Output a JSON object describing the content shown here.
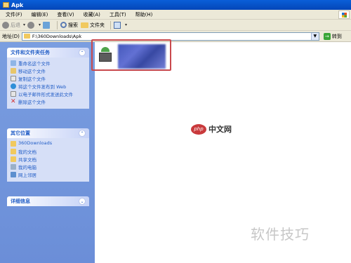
{
  "window": {
    "title": "Apk"
  },
  "menu": [
    "文件(F)",
    "编辑(E)",
    "查看(V)",
    "收藏(A)",
    "工具(T)",
    "帮助(H)"
  ],
  "toolbar": {
    "back": "后退",
    "search": "搜索",
    "folders": "文件夹"
  },
  "address": {
    "label": "地址(D)",
    "value": "F:\\360Downloads\\Apk",
    "go": "转到"
  },
  "tasks_panel": {
    "title": "文件和文件夹任务",
    "items": [
      {
        "label": "重命名这个文件",
        "icon": "rename-icon"
      },
      {
        "label": "移动这个文件",
        "icon": "move-icon"
      },
      {
        "label": "复制这个文件",
        "icon": "copy-icon"
      },
      {
        "label": "将这个文件发布到 Web",
        "icon": "web-publish-icon"
      },
      {
        "label": "以电子邮件形式发送此文件",
        "icon": "email-icon"
      },
      {
        "label": "删除这个文件",
        "icon": "delete-icon"
      }
    ]
  },
  "other_places": {
    "title": "其它位置",
    "items": [
      {
        "label": "360Downloads",
        "icon": "folder-icon"
      },
      {
        "label": "我的文档",
        "icon": "my-documents-icon"
      },
      {
        "label": "共享文档",
        "icon": "shared-documents-icon"
      },
      {
        "label": "我的电脑",
        "icon": "my-computer-icon"
      },
      {
        "label": "网上邻居",
        "icon": "network-places-icon"
      }
    ]
  },
  "details": {
    "title": "详细信息"
  },
  "watermark": {
    "site": "中文网",
    "logo": "php",
    "corner": "软件技巧"
  },
  "colors": {
    "titlebar": "#0a5fd8",
    "taskpane": "#7a9ee0",
    "highlight_box": "#c9494d"
  }
}
